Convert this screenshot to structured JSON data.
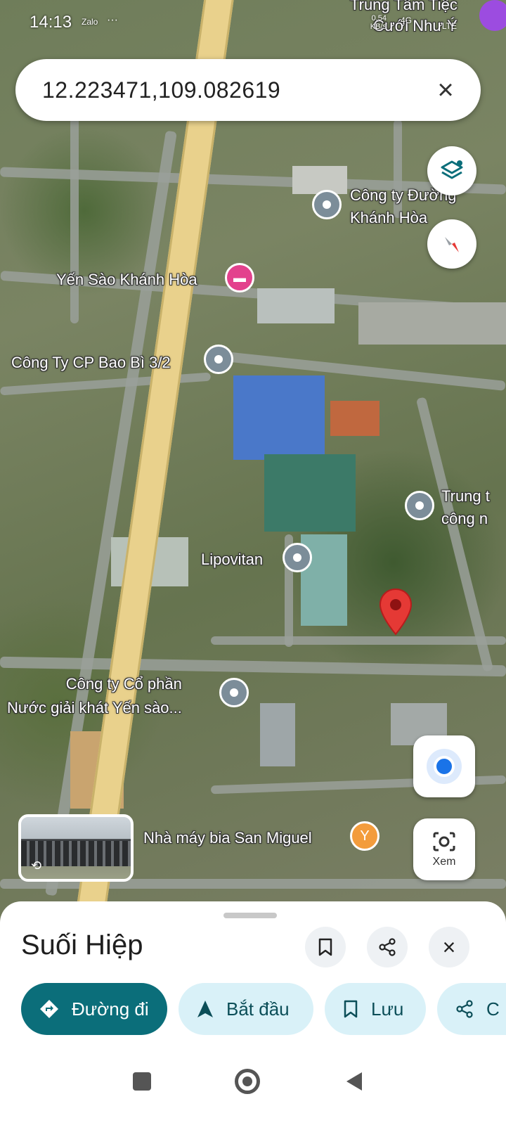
{
  "status_bar": {
    "time": "14:13",
    "app_label": "Zalo",
    "dots": "···",
    "net_speed": "0,54\nKB/s",
    "signal": "4G",
    "battery": "LTE"
  },
  "search": {
    "value": "12.223471,109.082619",
    "close_label": "×"
  },
  "map": {
    "pois": [
      {
        "label": "Trung Tâm Tiệc\nCưới Như Ý",
        "type": "top-label"
      },
      {
        "label": "Công ty Đường\nKhánh Hòa",
        "type": "generic"
      },
      {
        "label": "Yến Sào Khánh Hòa",
        "type": "hotel"
      },
      {
        "label": "Công Ty CP Bao Bì 3/2",
        "type": "generic"
      },
      {
        "label": "Trung t\ncông n",
        "type": "generic"
      },
      {
        "label": "Lipovitan",
        "type": "generic"
      },
      {
        "label": "Công ty Cổ phần\nNước giải khát Yến sào...",
        "type": "generic"
      },
      {
        "label": "Nhà máy bia San Miguel",
        "type": "bar"
      }
    ],
    "dropped_pin": "red-pin"
  },
  "controls": {
    "layers": "layers-icon",
    "compass": "compass-icon",
    "my_location": "my-location-icon",
    "lens_label": "Xem"
  },
  "sheet": {
    "title": "Suối Hiệp",
    "chips": [
      {
        "label": "Đường đi",
        "icon": "directions-icon"
      },
      {
        "label": "Bắt đầu",
        "icon": "navigation-icon"
      },
      {
        "label": "Lưu",
        "icon": "bookmark-icon"
      },
      {
        "label": "C",
        "icon": "share-icon"
      }
    ]
  },
  "colors": {
    "primary_chip": "#0b6e7a",
    "secondary_chip": "#d9f1f8",
    "pin_red": "#e53935",
    "location_blue": "#1a73e8"
  }
}
